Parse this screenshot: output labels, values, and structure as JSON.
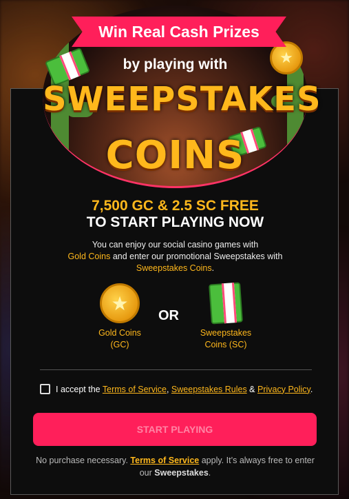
{
  "hero": {
    "ribbon": "Win Real Cash Prizes",
    "subtitle": "by playing with",
    "title_line1": "SWEEPSTAKES",
    "title_line2": "COINS"
  },
  "offer": {
    "line1": "7,500 GC & 2.5 SC FREE",
    "line2": "TO START PLAYING NOW"
  },
  "description": {
    "part1": "You can enjoy our social casino games with",
    "gold": "Gold Coins",
    "part2": " and enter our promotional Sweepstakes with ",
    "sweeps": "Sweepstakes Coins",
    "part3": "."
  },
  "coins": {
    "gold_label_1": "Gold Coins",
    "gold_label_2": "(GC)",
    "or": "OR",
    "sweeps_label_1": "Sweepstakes",
    "sweeps_label_2": "Coins (SC)"
  },
  "consent": {
    "prefix": "I accept the ",
    "terms": "Terms of Service",
    "sep1": ", ",
    "rules": "Sweepstakes Rules",
    "sep2": " & ",
    "privacy": "Privacy Policy",
    "suffix": "."
  },
  "button": {
    "label": "START PLAYING"
  },
  "footer": {
    "part1": "No purchase necessary. ",
    "terms": "Terms of Service",
    "part2": " apply. It’s always free to enter our ",
    "sweeps": "Sweepstakes",
    "part3": "."
  },
  "colors": {
    "accent": "#ff1f5a",
    "gold": "#ffb81c",
    "panel": "#0d0d0d"
  }
}
